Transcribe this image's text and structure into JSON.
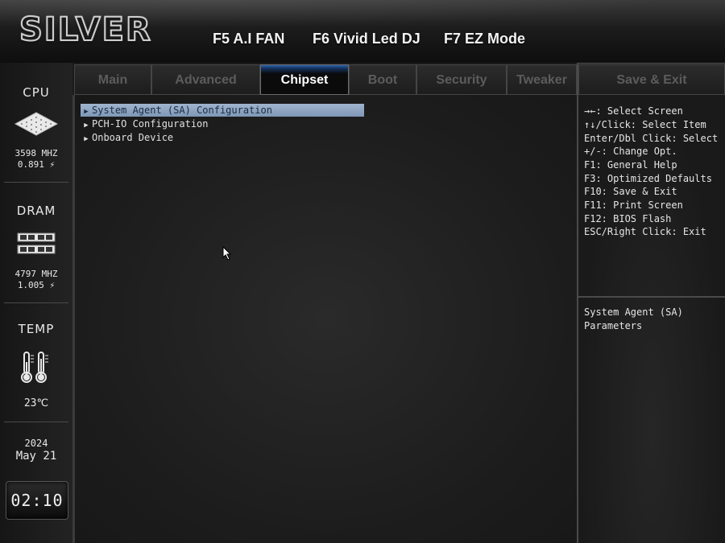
{
  "header": {
    "logo": "SILVER",
    "hotkeys": [
      "F5 A.I FAN",
      "F6 Vivid Led DJ",
      "F7 EZ Mode"
    ]
  },
  "tabs": [
    {
      "label": "Main"
    },
    {
      "label": "Advanced"
    },
    {
      "label": "Chipset"
    },
    {
      "label": "Boot"
    },
    {
      "label": "Security"
    },
    {
      "label": "Tweaker"
    }
  ],
  "save_exit_label": "Save & Exit",
  "active_tab": "Chipset",
  "sidebar": {
    "cpu": {
      "title": "CPU",
      "freq": "3598 MHZ",
      "volt": "0.891 ⚡"
    },
    "dram": {
      "title": "DRAM",
      "freq": "4797 MHZ",
      "volt": "1.005 ⚡"
    },
    "temp": {
      "title": "TEMP",
      "value": "23℃"
    },
    "date": {
      "year": "2024",
      "month_day": "May 21"
    },
    "time": "02:10"
  },
  "menu": [
    {
      "label": "System Agent (SA) Configuration",
      "selected": true
    },
    {
      "label": "PCH-IO Configuration",
      "selected": false
    },
    {
      "label": "Onboard Device",
      "selected": false
    }
  ],
  "help": {
    "keys": [
      "→←: Select Screen",
      "↑↓/Click: Select Item",
      "Enter/Dbl Click: Select",
      "+/-: Change Opt.",
      "F1: General Help",
      "F3: Optimized Defaults",
      "F10: Save & Exit",
      "F11: Print Screen",
      "F12: BIOS Flash",
      "ESC/Right Click: Exit"
    ],
    "description": [
      "System Agent (SA)",
      "Parameters"
    ]
  },
  "colors": {
    "active_tab_accent": "#2a5fa8",
    "selection_bg": "#8fa6c4"
  }
}
